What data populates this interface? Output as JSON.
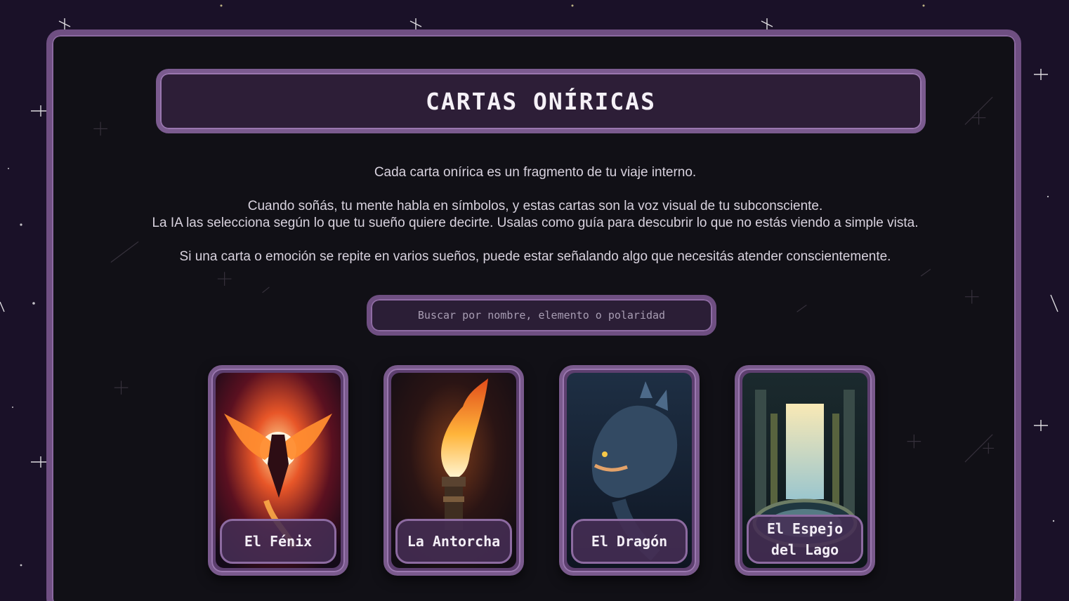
{
  "page": {
    "title": "CARTAS ONÍRICAS"
  },
  "intro": {
    "line1": "Cada carta onírica es un fragmento de tu viaje interno.",
    "line2": "Cuando soñás, tu mente habla en símbolos, y estas cartas son la voz visual de tu subconsciente.",
    "line3": "La IA las selecciona según lo que tu sueño quiere decirte. Usalas como guía para descubrir lo que no estás viendo a simple vista.",
    "line4": "Si una carta o emoción se repite en varios sueños, puede estar señalando algo que necesitás atender conscientemente."
  },
  "search": {
    "placeholder": "Buscar por nombre, elemento o polaridad",
    "value": ""
  },
  "cards": [
    {
      "label": "El Fénix",
      "art": "phoenix-illustration"
    },
    {
      "label": "La Antorcha",
      "art": "torch-illustration"
    },
    {
      "label": "El Dragón",
      "art": "dragon-illustration"
    },
    {
      "label": "El Espejo del Lago",
      "art": "lake-mirror-illustration"
    }
  ],
  "colors": {
    "background": "#1a1128",
    "panel": "#111016",
    "accent": "#7b5b8f",
    "text": "#f5f1f7"
  }
}
